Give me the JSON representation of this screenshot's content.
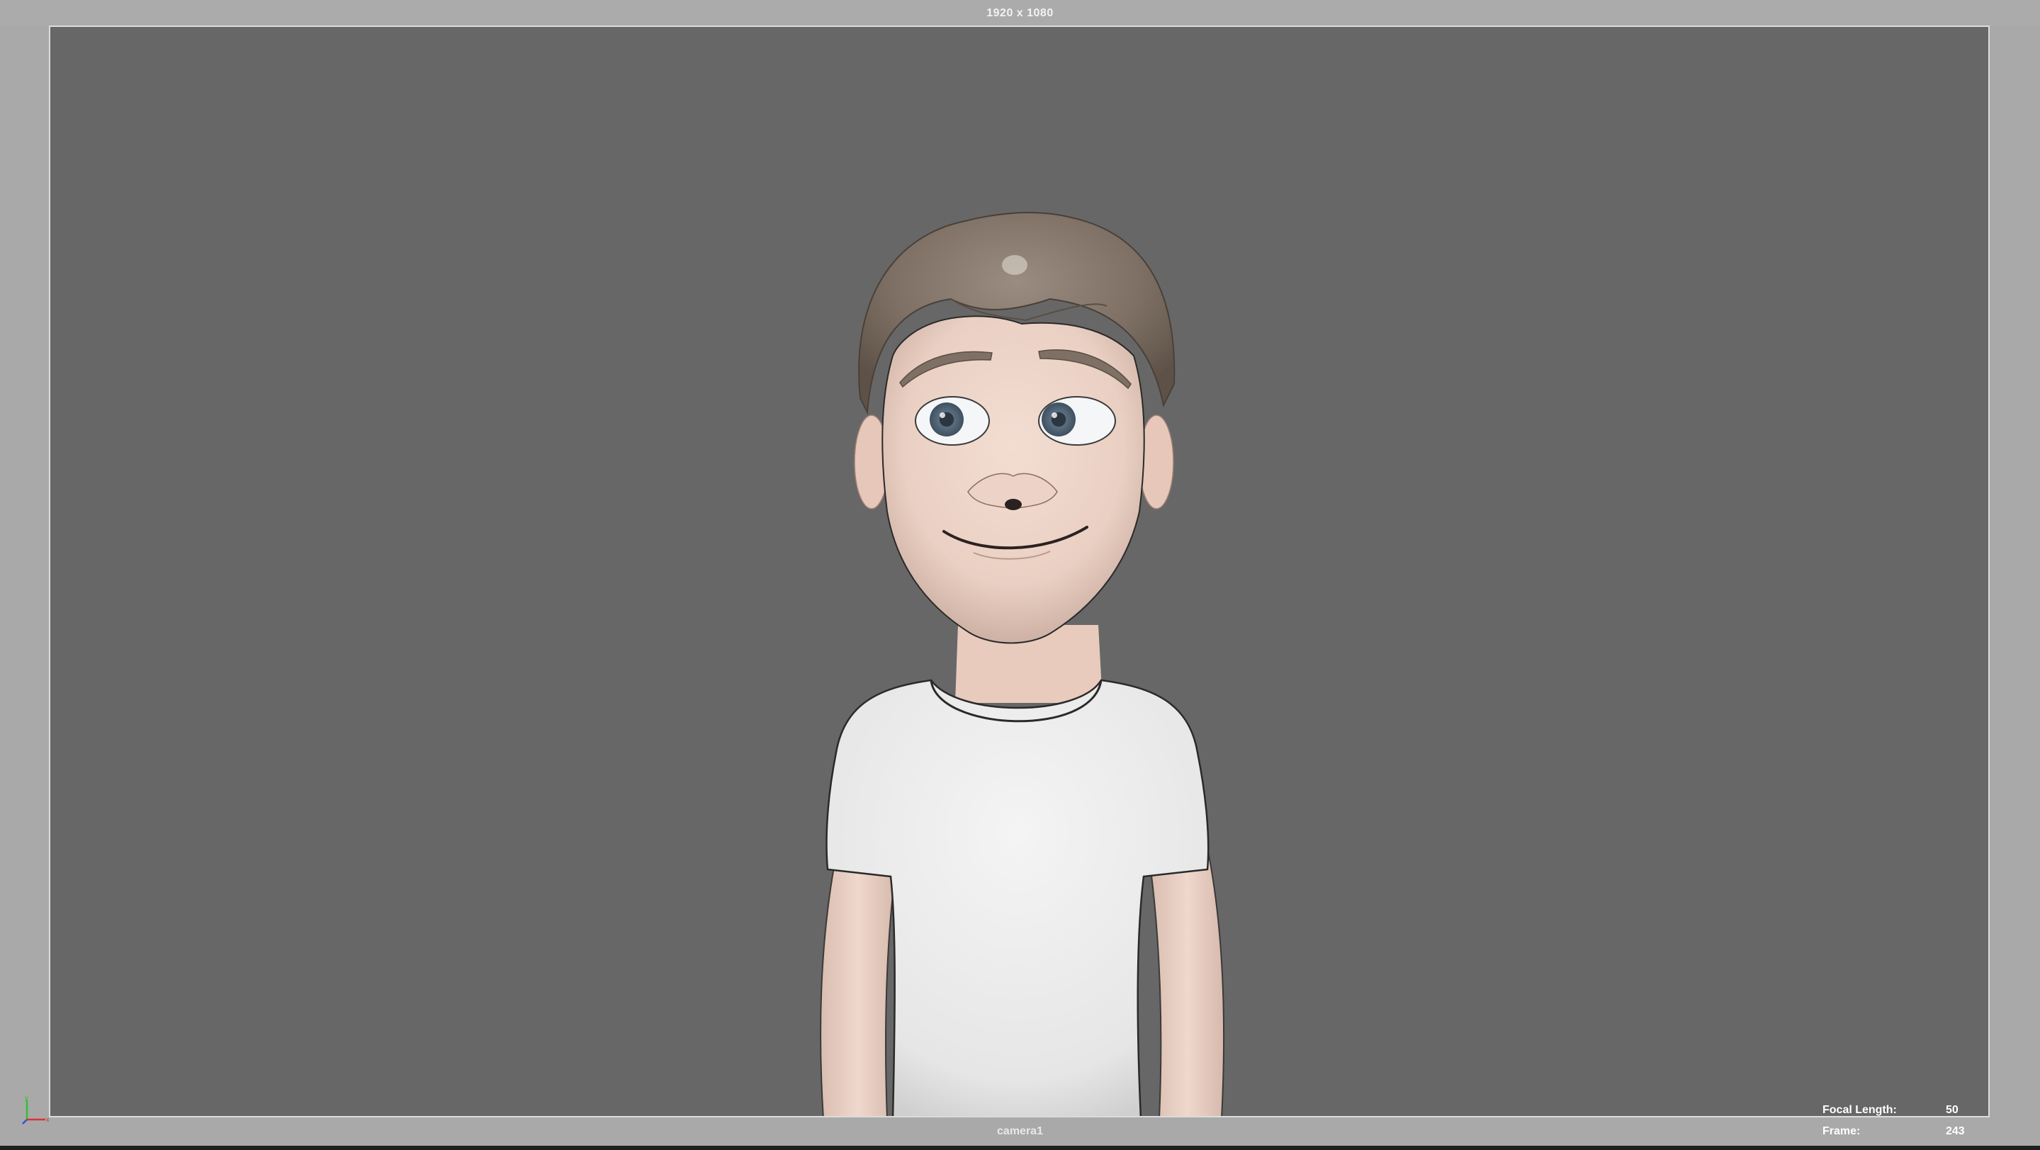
{
  "viewport": {
    "resolution_label": "1920 x 1080",
    "camera_label": "camera1",
    "gate_color": "#676767",
    "outer_color": "#a9a9a9"
  },
  "hud": {
    "focal_length_label": "Focal Length:",
    "focal_length_value": "50",
    "frame_label": "Frame:",
    "frame_value": "243"
  },
  "gizmo": {
    "x_color": "#e03030",
    "y_color": "#30c030",
    "z_color": "#3050e0",
    "icon": "axis-gizmo-icon"
  },
  "scene": {
    "subject": "cartoon-character",
    "shirt_color": "#ececec",
    "skin_color": "#eccfc2",
    "hair_color": "#7e7064",
    "iris_color": "#4f6273"
  }
}
